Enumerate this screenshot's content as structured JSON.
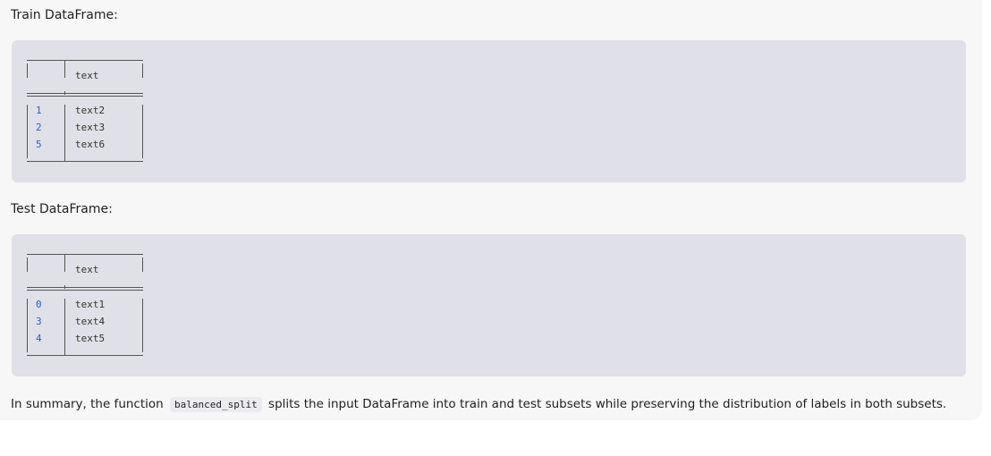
{
  "train": {
    "heading": "Train DataFrame:",
    "column": "text",
    "rows": [
      {
        "index": "1",
        "value": "text2"
      },
      {
        "index": "2",
        "value": "text3"
      },
      {
        "index": "5",
        "value": "text6"
      }
    ]
  },
  "test": {
    "heading": "Test DataFrame:",
    "column": "text",
    "rows": [
      {
        "index": "0",
        "value": "text1"
      },
      {
        "index": "3",
        "value": "text4"
      },
      {
        "index": "4",
        "value": "text5"
      }
    ]
  },
  "summary": {
    "before": "In summary, the function",
    "code": "balanced_split",
    "after": "splits the input DataFrame into train and test subsets while preserving the distribution of labels in both subsets."
  },
  "colors": {
    "message_bg": "#f7f7f8",
    "code_block_bg": "#e0e0e8",
    "index_text": "#2f5fbf"
  }
}
